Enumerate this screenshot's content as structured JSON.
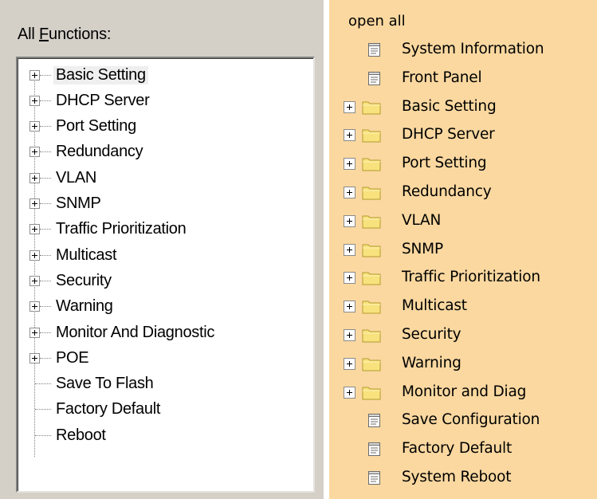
{
  "left_panel": {
    "label_prefix": "All ",
    "label_accel": "F",
    "label_rest": "unctions:",
    "items": [
      {
        "label": "Basic Setting",
        "expandable": true,
        "selected": true
      },
      {
        "label": "DHCP Server",
        "expandable": true
      },
      {
        "label": "Port Setting",
        "expandable": true
      },
      {
        "label": "Redundancy",
        "expandable": true
      },
      {
        "label": "VLAN",
        "expandable": true
      },
      {
        "label": "SNMP",
        "expandable": true
      },
      {
        "label": "Traffic Prioritization",
        "expandable": true
      },
      {
        "label": "Multicast",
        "expandable": true
      },
      {
        "label": "Security",
        "expandable": true
      },
      {
        "label": "Warning",
        "expandable": true
      },
      {
        "label": "Monitor And Diagnostic",
        "expandable": true
      },
      {
        "label": "POE",
        "expandable": true
      },
      {
        "label": "Save To Flash",
        "expandable": false
      },
      {
        "label": "Factory Default",
        "expandable": false
      },
      {
        "label": "Reboot",
        "expandable": false
      }
    ]
  },
  "right_panel": {
    "open_all": "open all",
    "items": [
      {
        "label": "System Information",
        "icon": "page-icon"
      },
      {
        "label": "Front Panel",
        "icon": "page-icon"
      },
      {
        "label": "Basic Setting",
        "icon": "folder-icon"
      },
      {
        "label": "DHCP Server",
        "icon": "folder-icon"
      },
      {
        "label": "Port Setting",
        "icon": "folder-icon"
      },
      {
        "label": "Redundancy",
        "icon": "folder-icon"
      },
      {
        "label": "VLAN",
        "icon": "folder-icon"
      },
      {
        "label": "SNMP",
        "icon": "folder-icon"
      },
      {
        "label": "Traffic Prioritization",
        "icon": "folder-icon"
      },
      {
        "label": "Multicast",
        "icon": "folder-icon"
      },
      {
        "label": "Security",
        "icon": "folder-icon"
      },
      {
        "label": "Warning",
        "icon": "folder-icon"
      },
      {
        "label": "Monitor and Diag",
        "icon": "folder-icon"
      },
      {
        "label": "Save Configuration",
        "icon": "page-icon"
      },
      {
        "label": "Factory Default",
        "icon": "page-icon"
      },
      {
        "label": "System Reboot",
        "icon": "page-icon"
      }
    ]
  },
  "colors": {
    "left_background": "#d4d0c8",
    "right_background": "#fad8a0",
    "folder_fill": "#f7e27d",
    "folder_stroke": "#b59b2e"
  }
}
